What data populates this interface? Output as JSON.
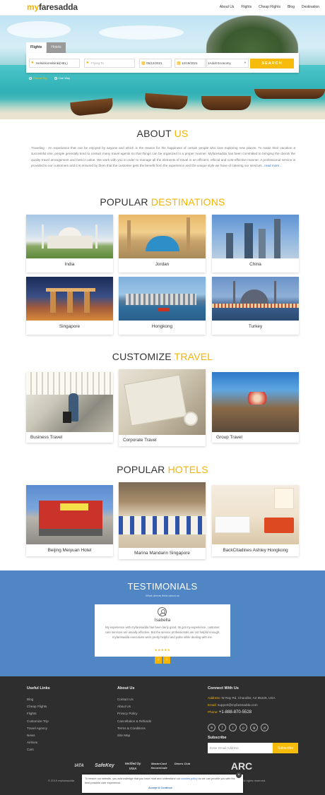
{
  "header": {
    "logo_my": "my",
    "logo_rest": "faresadda",
    "nav": [
      "About Us",
      "Flights",
      "Cheap Flights",
      "Blog",
      "Destination"
    ]
  },
  "search": {
    "tabs": [
      "Flights",
      "Hotels"
    ],
    "from": "Helsinki-Helsinki(HEL)",
    "to_placeholder": "Flying To",
    "depart": "05/12/2021",
    "return": "12/19/2021",
    "travellers": "1Adult Economy",
    "button": "SEARCH",
    "trip_types": [
      "Round Trip",
      "One Way"
    ],
    "selected_trip": "Round Trip"
  },
  "about": {
    "title_a": "ABOUT",
    "title_b": "US",
    "text": "Traveling - An experience that can be enjoyed by anyone and which is the reason for the happiness of certain people who love exploring new places. To make their vacation a successful one, people generally tend to contact many travel agents so that things can be organized in a proper manner. Myfaresadda has been committed to bringing the clients the quality travel arrangement and best in value. We work with you in order to manage all the elements of travel in an efficient, ethical and cost-effective manner. A professional service is provided to our customers and it is ensured by them that the customer gets the benefit from the experience and the unique style we have of catering our services...",
    "read_more": "read more..."
  },
  "destinations": {
    "title_a": "POPULAR",
    "title_b": "DESTINATIONS",
    "items": [
      "India",
      "Jordan",
      "China",
      "Singapore",
      "Hongkong",
      "Turkey"
    ]
  },
  "customize": {
    "title_a": "CUSTOMIZE",
    "title_b": "TRAVEL",
    "items": [
      "Business Travel",
      "Corporate Travel",
      "Group Travel"
    ]
  },
  "hotels": {
    "title_a": "POPULAR",
    "title_b": "HOTELS",
    "items": [
      "Beijing Meiyuan Hotel",
      "Marina Mandarin Singapore",
      "BackCitadines Ashley Hongkong"
    ]
  },
  "testimonials": {
    "title": "TESTIMONIALS",
    "subtitle": "What clients think about us",
    "name": "Isabella",
    "text": "My experience with myfaresadda has been fairly good. Its got my experience, customer care services are usually effective. But the service professionals are not helpful enough. myfaresadda executives were pretty helpful and polite while dealing with me.",
    "stars": "★★★★★",
    "prev": "‹",
    "next": "›"
  },
  "footer": {
    "useful_title": "Useful Links",
    "useful": [
      "Blog",
      "Cheap Flights",
      "Flights",
      "Customize Trip",
      "Travel Agency",
      "News",
      "Airlines",
      "Cars"
    ],
    "about_title": "About Us",
    "about": [
      "Contact Us",
      "About Us",
      "Privacy Policy",
      "Cancellation & Refunds",
      "Terms & Conditions",
      "Site Map"
    ],
    "connect_title": "Connect With Us",
    "address_label": "Address:",
    "address": "W Ray Rd, Chandler, AZ 85226, USA",
    "email_label": "Email:",
    "email": "support@myfaresadda.com",
    "phone_label": "Phone:",
    "phone": "+1-888-870-5528",
    "social": [
      "in",
      "f",
      "t",
      "p",
      "ig",
      "yt"
    ],
    "subscribe_title": "Subscribe",
    "subscribe_placeholder": "Enter Email Address",
    "subscribe_button": "Subscribe",
    "badges": [
      "IATA",
      "SafeKey",
      "Verified by VISA",
      "MasterCard SecureCode",
      "Diners Club",
      "ARC"
    ],
    "copyright_left": "© 2019 myfaresadda",
    "copyright_right": "All rights reserved."
  },
  "cookie": {
    "text": "To ensure our website, you acknowledge that you have read and understand our",
    "link": "cookies policy",
    "text2": "so we can provide you with the best possible user experience.",
    "accept": "Accept & Continue",
    "close": "×"
  },
  "colors": {
    "accent": "#f5b400",
    "blue": "#4f86c3",
    "footer": "#2e2e2e"
  }
}
